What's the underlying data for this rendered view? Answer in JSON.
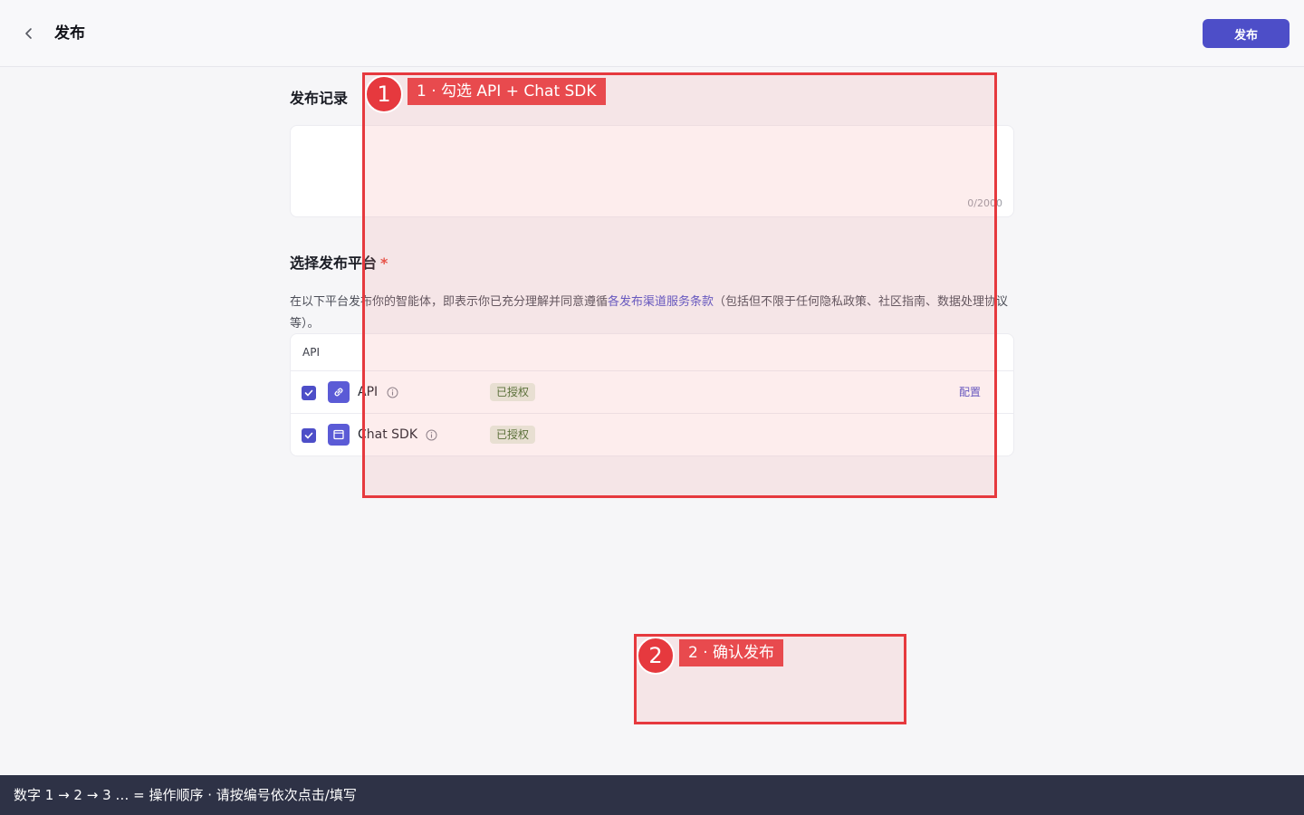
{
  "header": {
    "title": "发布",
    "publish_label": "发布"
  },
  "record": {
    "title": "发布记录",
    "value": "",
    "char_count": "0/2000"
  },
  "platform": {
    "title": "选择发布平台",
    "required_mark": "*",
    "desc_before": "在以下平台发布你的智能体，即表示你已充分理解并同意遵循",
    "desc_link": "各发布渠道服务条款",
    "desc_after": "（包括但不限于任何隐私政策、社区指南、数据处理协议等）。",
    "table_header": "API",
    "rows": [
      {
        "name": "API",
        "status": "已授权",
        "action": "配置",
        "checked": true,
        "icon": "link-icon"
      },
      {
        "name": "Chat SDK",
        "status": "已授权",
        "action": "",
        "checked": true,
        "icon": "window-icon"
      }
    ]
  },
  "annotations": [
    {
      "number": "1",
      "label": "1 · 勾选 API + Chat SDK"
    },
    {
      "number": "2",
      "label": "2 · 确认发布"
    }
  ],
  "bottom_bar": {
    "text": "数字 1 → 2 → 3 … = 操作顺序 · 请按编号依次点击/填写"
  },
  "colors": {
    "accent": "#4d4ec8",
    "annotation": "#e6393e",
    "badge_bg": "#e6efdf",
    "badge_text": "#3f6b2a",
    "bottom_bar": "#2e3246"
  }
}
